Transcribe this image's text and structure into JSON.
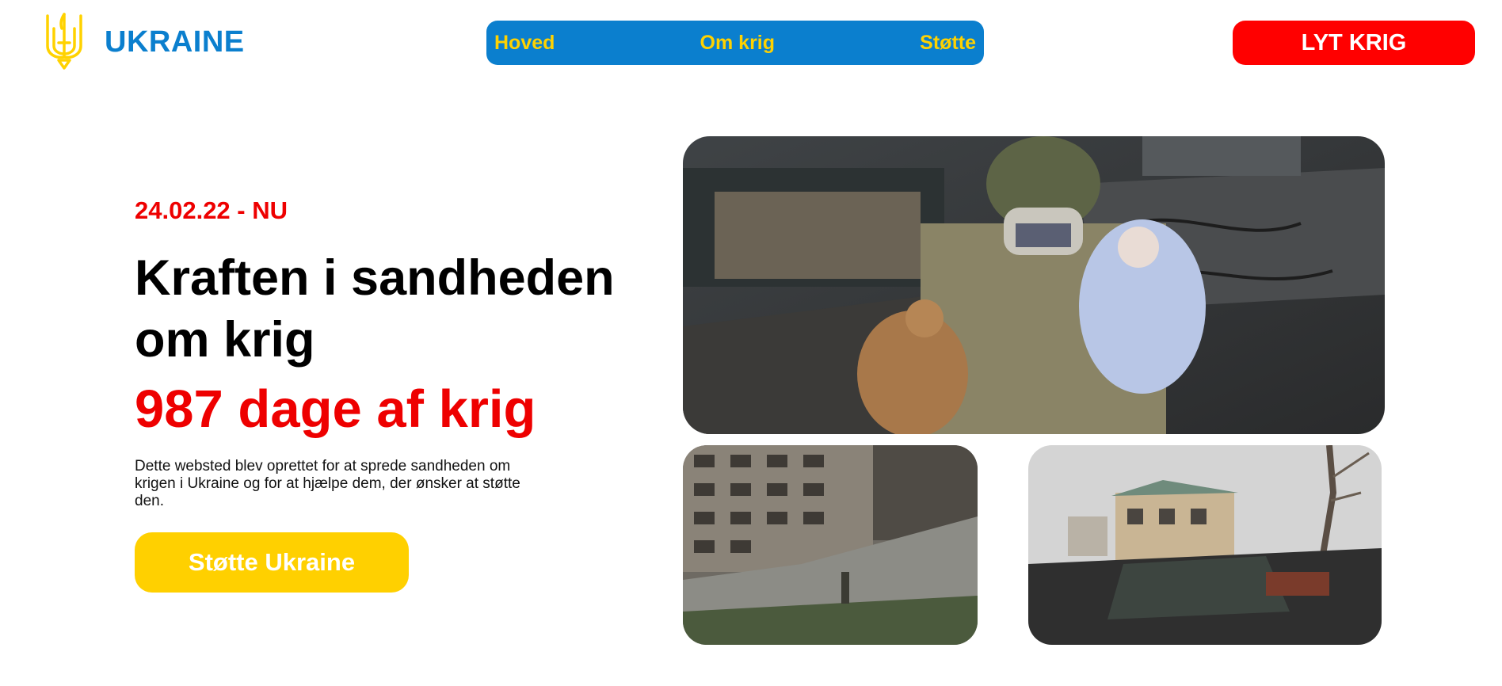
{
  "header": {
    "logo_icon": "trident-icon",
    "logo_text": "UKRAINE",
    "nav": [
      {
        "label": "Hoved"
      },
      {
        "label": "Om krig"
      },
      {
        "label": "Støtte"
      }
    ],
    "listen_button": "LYT KRIG"
  },
  "hero": {
    "date_range": "24.02.22 - NU",
    "headline": "Kraften i sandheden om krig",
    "days_count": "987 dage af krig",
    "description": "Dette websted blev oprettet for at sprede sandheden om krigen i Ukraine og for at hjælpe dem, der ønsker at støtte den.",
    "support_button": "Støtte Ukraine"
  },
  "photos": [
    {
      "name": "soldier-with-baby-photo"
    },
    {
      "name": "destroyed-building-photo"
    },
    {
      "name": "destroyed-house-photo"
    }
  ],
  "colors": {
    "brand_blue": "#0b7fce",
    "brand_yellow": "#ffd200",
    "alert_red": "#ff0000",
    "support_yellow": "#ffd000"
  }
}
